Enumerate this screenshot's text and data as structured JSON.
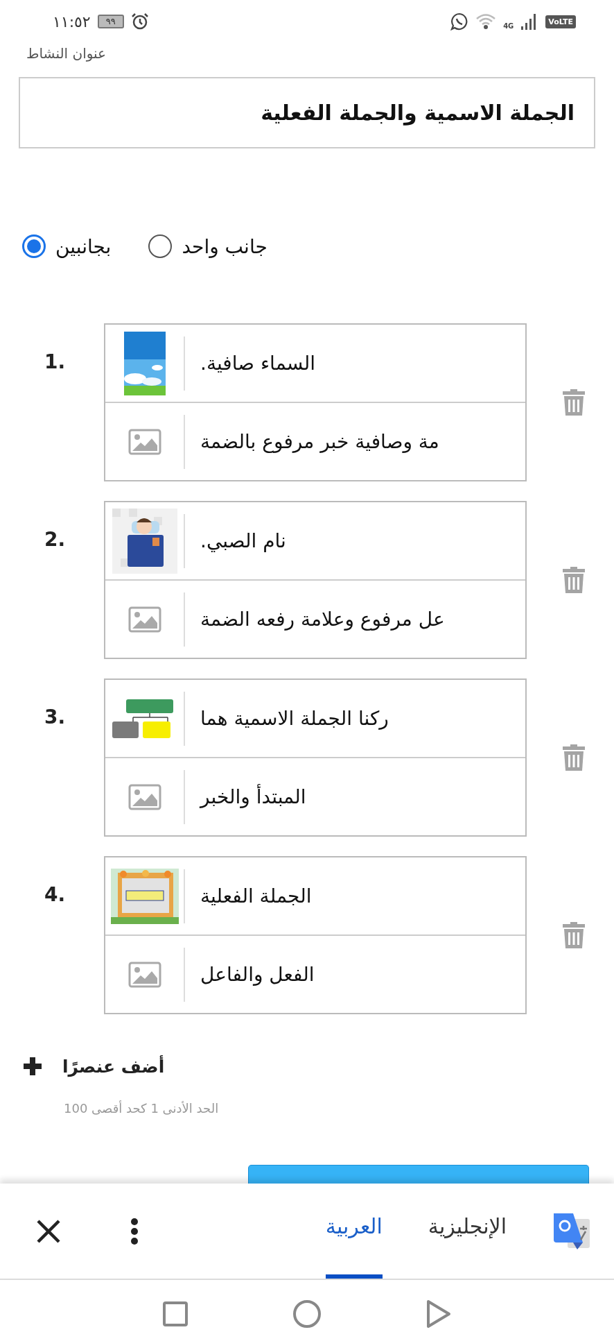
{
  "status_bar": {
    "time": "١١:٥٢",
    "battery": "٩٩",
    "network": "4G",
    "volte": "VoLTE"
  },
  "section_label": "عنوان النشاط",
  "title_field": {
    "value": "الجملة الاسمية والجملة الفعلية"
  },
  "sides": [
    {
      "label": "جانب واحد",
      "selected": false
    },
    {
      "label": "بجانبين",
      "selected": true
    }
  ],
  "items": [
    {
      "number": "1.",
      "front": {
        "text": "السماء صافية.",
        "has_image": true
      },
      "back": {
        "text": "مة وصافية خبر مرفوع بالضمة",
        "has_image": false
      }
    },
    {
      "number": "2.",
      "front": {
        "text": "نام الصبي.",
        "has_image": true
      },
      "back": {
        "text": "عل مرفوع وعلامة رفعه الضمة",
        "has_image": false
      }
    },
    {
      "number": "3.",
      "front": {
        "text": "ركنا الجملة الاسمية هما",
        "has_image": true
      },
      "back": {
        "text": "المبتدأ والخبر",
        "has_image": false
      }
    },
    {
      "number": "4.",
      "front": {
        "text": "الجملة الفعلية",
        "has_image": true
      },
      "back": {
        "text": "الفعل والفاعل",
        "has_image": false
      }
    }
  ],
  "add_button": "أضف عنصرًا",
  "limit_hint": "الحد الأدنى 1 كحد أقصى 100",
  "translate_bar": {
    "languages": [
      {
        "label": "الإنجليزية",
        "selected": false
      },
      {
        "label": "العربية",
        "selected": true
      }
    ]
  }
}
